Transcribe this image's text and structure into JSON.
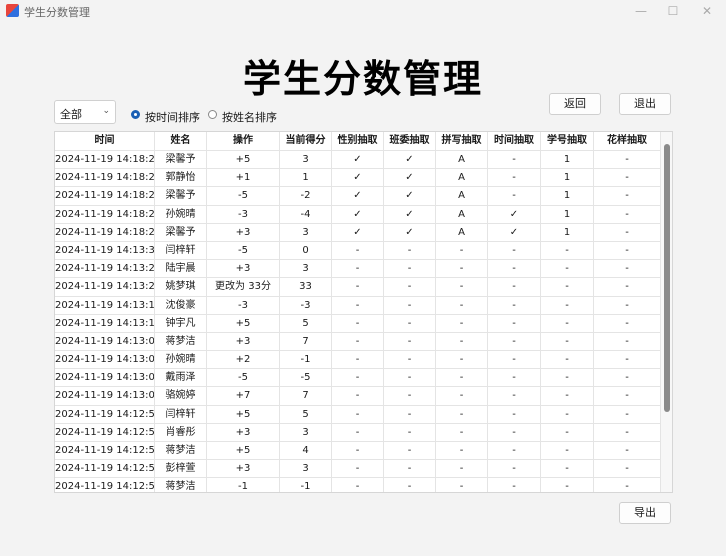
{
  "window": {
    "title": "学生分数管理",
    "min_glyph": "—",
    "max_glyph": "☐",
    "close_glyph": "✕"
  },
  "header": {
    "title": "学生分数管理"
  },
  "filter": {
    "selected": "全部",
    "chevron": "⌄"
  },
  "sort": {
    "by_time": "按时间排序",
    "by_name": "按姓名排序"
  },
  "buttons": {
    "back": "返回",
    "exit": "退出",
    "export": "导出"
  },
  "colors": {
    "accent": "#1a5fb4"
  },
  "table": {
    "columns": [
      "时间",
      "姓名",
      "操作",
      "当前得分",
      "性别抽取",
      "班委抽取",
      "拼写抽取",
      "时间抽取",
      "学号抽取",
      "花样抽取"
    ],
    "rows": [
      [
        "2024-11-19 14:18:29",
        "梁馨予",
        "+5",
        "3",
        "✓",
        "✓",
        "A",
        "-",
        "1",
        "-"
      ],
      [
        "2024-11-19 14:18:28",
        "郭静怡",
        "+1",
        "1",
        "✓",
        "✓",
        "A",
        "-",
        "1",
        "-"
      ],
      [
        "2024-11-19 14:18:26",
        "梁馨予",
        "-5",
        "-2",
        "✓",
        "✓",
        "A",
        "-",
        "1",
        "-"
      ],
      [
        "2024-11-19 14:18:23",
        "孙婉晴",
        "-3",
        "-4",
        "✓",
        "✓",
        "A",
        "✓",
        "1",
        "-"
      ],
      [
        "2024-11-19 14:18:20",
        "梁馨予",
        "+3",
        "3",
        "✓",
        "✓",
        "A",
        "✓",
        "1",
        "-"
      ],
      [
        "2024-11-19 14:13:30",
        "闫梓轩",
        "-5",
        "0",
        "-",
        "-",
        "-",
        "-",
        "-",
        "-"
      ],
      [
        "2024-11-19 14:13:29",
        "陆宇晨",
        "+3",
        "3",
        "-",
        "-",
        "-",
        "-",
        "-",
        "-"
      ],
      [
        "2024-11-19 14:13:24",
        "姚梦琪",
        "更改为 33分",
        "33",
        "-",
        "-",
        "-",
        "-",
        "-",
        "-"
      ],
      [
        "2024-11-19 14:13:11",
        "沈俊豪",
        "-3",
        "-3",
        "-",
        "-",
        "-",
        "-",
        "-",
        "-"
      ],
      [
        "2024-11-19 14:13:10",
        "钟宇凡",
        "+5",
        "5",
        "-",
        "-",
        "-",
        "-",
        "-",
        "-"
      ],
      [
        "2024-11-19 14:13:09",
        "蒋梦洁",
        "+3",
        "7",
        "-",
        "-",
        "-",
        "-",
        "-",
        "-"
      ],
      [
        "2024-11-19 14:13:08",
        "孙婉晴",
        "+2",
        "-1",
        "-",
        "-",
        "-",
        "-",
        "-",
        "-"
      ],
      [
        "2024-11-19 14:13:06",
        "戴雨泽",
        "-5",
        "-5",
        "-",
        "-",
        "-",
        "-",
        "-",
        "-"
      ],
      [
        "2024-11-19 14:13:03",
        "骆婉婷",
        "+7",
        "7",
        "-",
        "-",
        "-",
        "-",
        "-",
        "-"
      ],
      [
        "2024-11-19 14:12:59",
        "闫梓轩",
        "+5",
        "5",
        "-",
        "-",
        "-",
        "-",
        "-",
        "-"
      ],
      [
        "2024-11-19 14:12:57",
        "肖睿彤",
        "+3",
        "3",
        "-",
        "-",
        "-",
        "-",
        "-",
        "-"
      ],
      [
        "2024-11-19 14:12:56",
        "蒋梦洁",
        "+5",
        "4",
        "-",
        "-",
        "-",
        "-",
        "-",
        "-"
      ],
      [
        "2024-11-19 14:12:55",
        "彭梓萱",
        "+3",
        "3",
        "-",
        "-",
        "-",
        "-",
        "-",
        "-"
      ],
      [
        "2024-11-19 14:12:53",
        "蒋梦洁",
        "-1",
        "-1",
        "-",
        "-",
        "-",
        "-",
        "-",
        "-"
      ]
    ]
  }
}
